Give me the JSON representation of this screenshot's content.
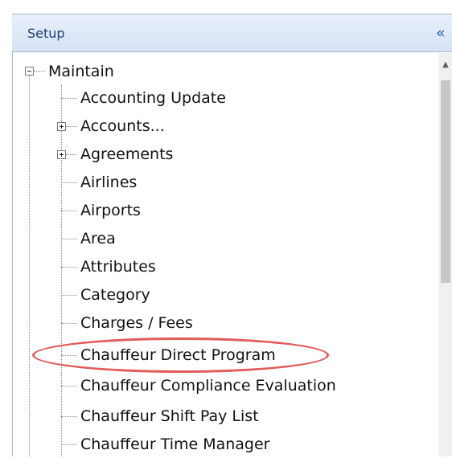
{
  "panel": {
    "title": "Setup",
    "collapse_glyph": "«"
  },
  "tree": {
    "root": {
      "label": "Maintain",
      "expanded": true
    },
    "items": [
      {
        "label": "Accounting Update",
        "expandable": false
      },
      {
        "label": "Accounts...",
        "expandable": true
      },
      {
        "label": "Agreements",
        "expandable": true
      },
      {
        "label": "Airlines",
        "expandable": false
      },
      {
        "label": "Airports",
        "expandable": false
      },
      {
        "label": "Area",
        "expandable": false
      },
      {
        "label": "Attributes",
        "expandable": false
      },
      {
        "label": "Category",
        "expandable": false
      },
      {
        "label": "Charges / Fees",
        "expandable": false
      },
      {
        "label": "Chauffeur Direct Program",
        "expandable": false,
        "highlighted": true
      },
      {
        "label": "Chauffeur Compliance Evaluation",
        "expandable": false
      },
      {
        "label": "Chauffeur Shift Pay List",
        "expandable": false
      },
      {
        "label": "Chauffeur Time Manager",
        "expandable": false
      }
    ]
  },
  "scrollbar": {
    "up_glyph": "▲"
  },
  "colors": {
    "header_bg": "#dce7f6",
    "header_text": "#1e3f6e",
    "highlight": "#e35b5b"
  }
}
